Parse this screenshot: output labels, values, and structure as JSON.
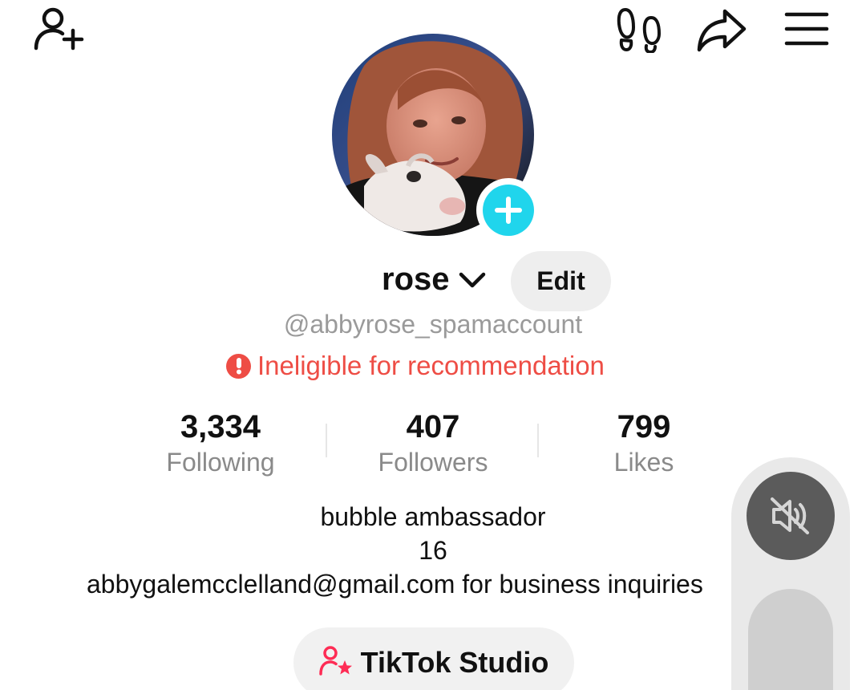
{
  "header": {
    "icons": [
      "add-friend-icon",
      "footprint-icon",
      "share-icon",
      "menu-icon"
    ]
  },
  "profile": {
    "display_name": "rose",
    "edit_label": "Edit",
    "handle": "@abbyrose_spamaccount",
    "warning": "Ineligible for recommendation",
    "warning_color": "#EE4D45",
    "avatar_badge_color": "#20D5EC"
  },
  "stats": [
    {
      "value": "3,334",
      "label": "Following"
    },
    {
      "value": "407",
      "label": "Followers"
    },
    {
      "value": "799",
      "label": "Likes"
    }
  ],
  "bio": {
    "line1": "bubble ambassador",
    "line2": "16",
    "line3": "abbygalemcclelland@gmail.com for business inquiries"
  },
  "studio_button": {
    "label": "TikTok Studio",
    "icon_color": "#FE2C55"
  },
  "side_panel": {
    "mute_icon": "speaker-muted-icon"
  }
}
